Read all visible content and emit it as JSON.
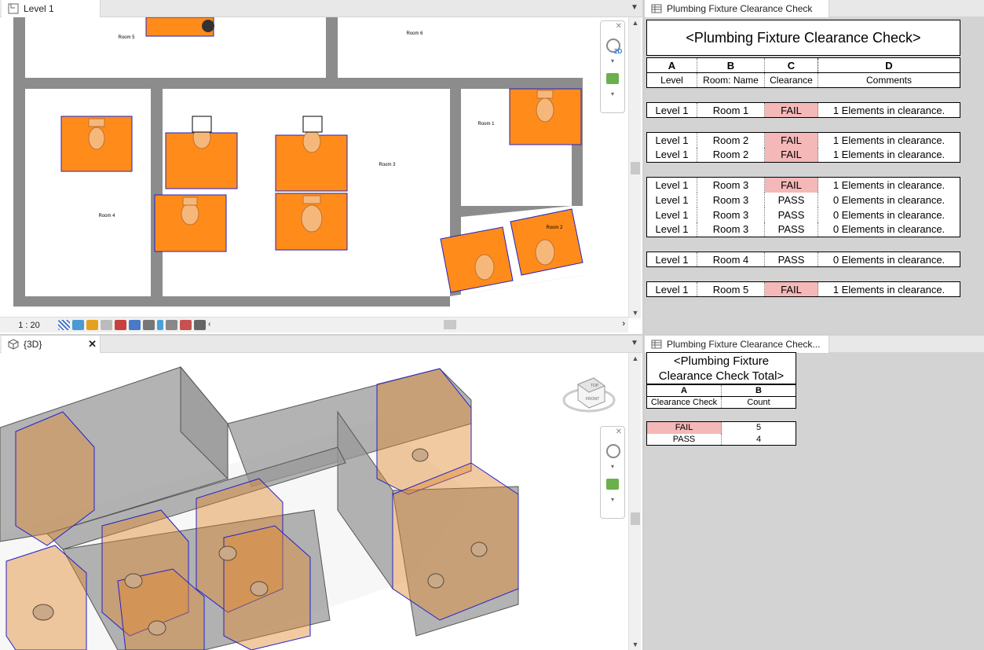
{
  "plan_view": {
    "tab_title": "Level 1",
    "scale": "1 : 20",
    "rooms": [
      "Room 5",
      "Room 1",
      "Room 3",
      "Room 4",
      "Room 2"
    ],
    "nav_2d_label": "2D"
  },
  "view_3d": {
    "tab_title": "{3D}",
    "viewcube_top": "TOP",
    "viewcube_front": "FRONT"
  },
  "schedule": {
    "tab_title": "Plumbing Fixture Clearance Check",
    "title": "<Plumbing Fixture Clearance Check>",
    "col_letters": [
      "A",
      "B",
      "C",
      "D"
    ],
    "headers": [
      "Level",
      "Room: Name",
      "Clearance",
      "Comments"
    ],
    "groups": [
      [
        [
          "Level 1",
          "Room 1",
          "FAIL",
          "1 Elements in clearance."
        ]
      ],
      [
        [
          "Level 1",
          "Room 2",
          "FAIL",
          "1 Elements in clearance."
        ],
        [
          "Level 1",
          "Room 2",
          "FAIL",
          "1 Elements in clearance."
        ]
      ],
      [
        [
          "Level 1",
          "Room 3",
          "FAIL",
          "1 Elements in clearance."
        ],
        [
          "Level 1",
          "Room 3",
          "PASS",
          "0 Elements in clearance."
        ],
        [
          "Level 1",
          "Room 3",
          "PASS",
          "0 Elements in clearance."
        ],
        [
          "Level 1",
          "Room 3",
          "PASS",
          "0 Elements in clearance."
        ]
      ],
      [
        [
          "Level 1",
          "Room 4",
          "PASS",
          "0 Elements in clearance."
        ]
      ],
      [
        [
          "Level 1",
          "Room 5",
          "FAIL",
          "1 Elements in clearance."
        ]
      ]
    ]
  },
  "total_schedule": {
    "tab_title": "Plumbing Fixture Clearance Check...",
    "title_line1": "<Plumbing Fixture",
    "title_line2": "Clearance Check Total>",
    "col_letters": [
      "A",
      "B"
    ],
    "headers": [
      "Clearance Check",
      "Count"
    ],
    "rows": [
      [
        "FAIL",
        "5"
      ],
      [
        "PASS",
        "4"
      ]
    ]
  },
  "colors": {
    "fail_bg": "#f4b8b8",
    "clearance_orange": "#ff8c1a",
    "clearance_outline": "#2222cc",
    "wall_gray": "#8c8c8c"
  }
}
